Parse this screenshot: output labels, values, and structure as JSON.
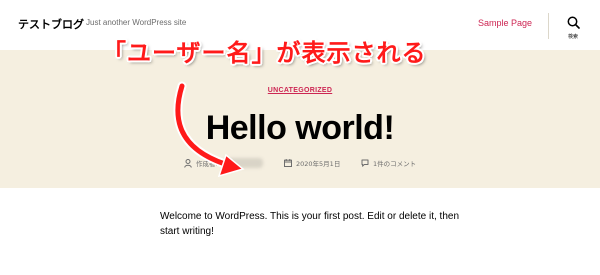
{
  "header": {
    "site_title": "テストブログ",
    "tagline": "Just another WordPress site",
    "nav": [
      {
        "label": "Sample Page"
      }
    ],
    "search_label": "検索"
  },
  "post": {
    "category": "UNCATEGORIZED",
    "title": "Hello world!",
    "meta": {
      "author_label": "作成者:",
      "date": "2020年5月1日",
      "comments": "1件のコメント"
    },
    "content": "Welcome to WordPress. This is your first post. Edit or delete it, then start writing!"
  },
  "annotation": {
    "callout": "「ユーザー名」が表示される",
    "color": "#ff1a1a"
  },
  "colors": {
    "accent": "#cd2653",
    "main_background": "#f5efe0",
    "meta_text": "#6d6d6d"
  },
  "icons": [
    "search-icon",
    "person-icon",
    "calendar-icon",
    "comment-icon",
    "arrow-icon"
  ]
}
